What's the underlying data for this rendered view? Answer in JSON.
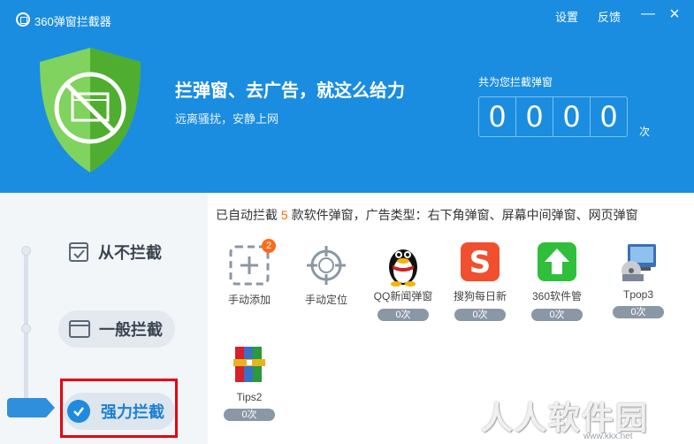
{
  "titlebar": {
    "app_title": "360弹窗拦截器",
    "settings": "设置",
    "feedback": "反馈",
    "minimize": "—",
    "close": "×"
  },
  "hero": {
    "slogan": "拦弹窗、去广告，就这么给力",
    "subslogan": "远离骚扰，安静上网",
    "counter_label": "共为您拦截弹窗",
    "digits": [
      "0",
      "0",
      "0",
      "0"
    ],
    "counter_unit": "次"
  },
  "modes": {
    "never": "从不拦截",
    "normal": "一般拦截",
    "strong": "强力拦截",
    "selected": "strong"
  },
  "info": {
    "prefix": "已自动拦截",
    "count": "5",
    "suffix": "款软件弹窗，广告类型：右下角弹窗、屏幕中间弹窗、网页弹窗"
  },
  "apps": [
    {
      "name": "手动添加",
      "badge": "2",
      "icon": "add-dashed-icon"
    },
    {
      "name": "手动定位",
      "icon": "crosshair-icon"
    },
    {
      "name": "QQ新闻弹窗",
      "count": "0次",
      "icon": "qq-penguin-icon"
    },
    {
      "name": "搜狗每日新",
      "count": "0次",
      "icon": "sogou-icon"
    },
    {
      "name": "360软件管",
      "count": "0次",
      "icon": "360-upload-icon"
    },
    {
      "name": "Tpop3",
      "count": "0次",
      "icon": "installer-icon"
    },
    {
      "name": "Tips2",
      "count": "0次",
      "icon": "winrar-books-icon"
    }
  ],
  "watermark": {
    "text": "人人软件园",
    "url": "www.kkx.net"
  },
  "colors": {
    "header_bg": "#1a8de0",
    "accent_orange": "#ff6a00",
    "shield_green": "#5bc03a",
    "highlight_red": "#e60012"
  }
}
